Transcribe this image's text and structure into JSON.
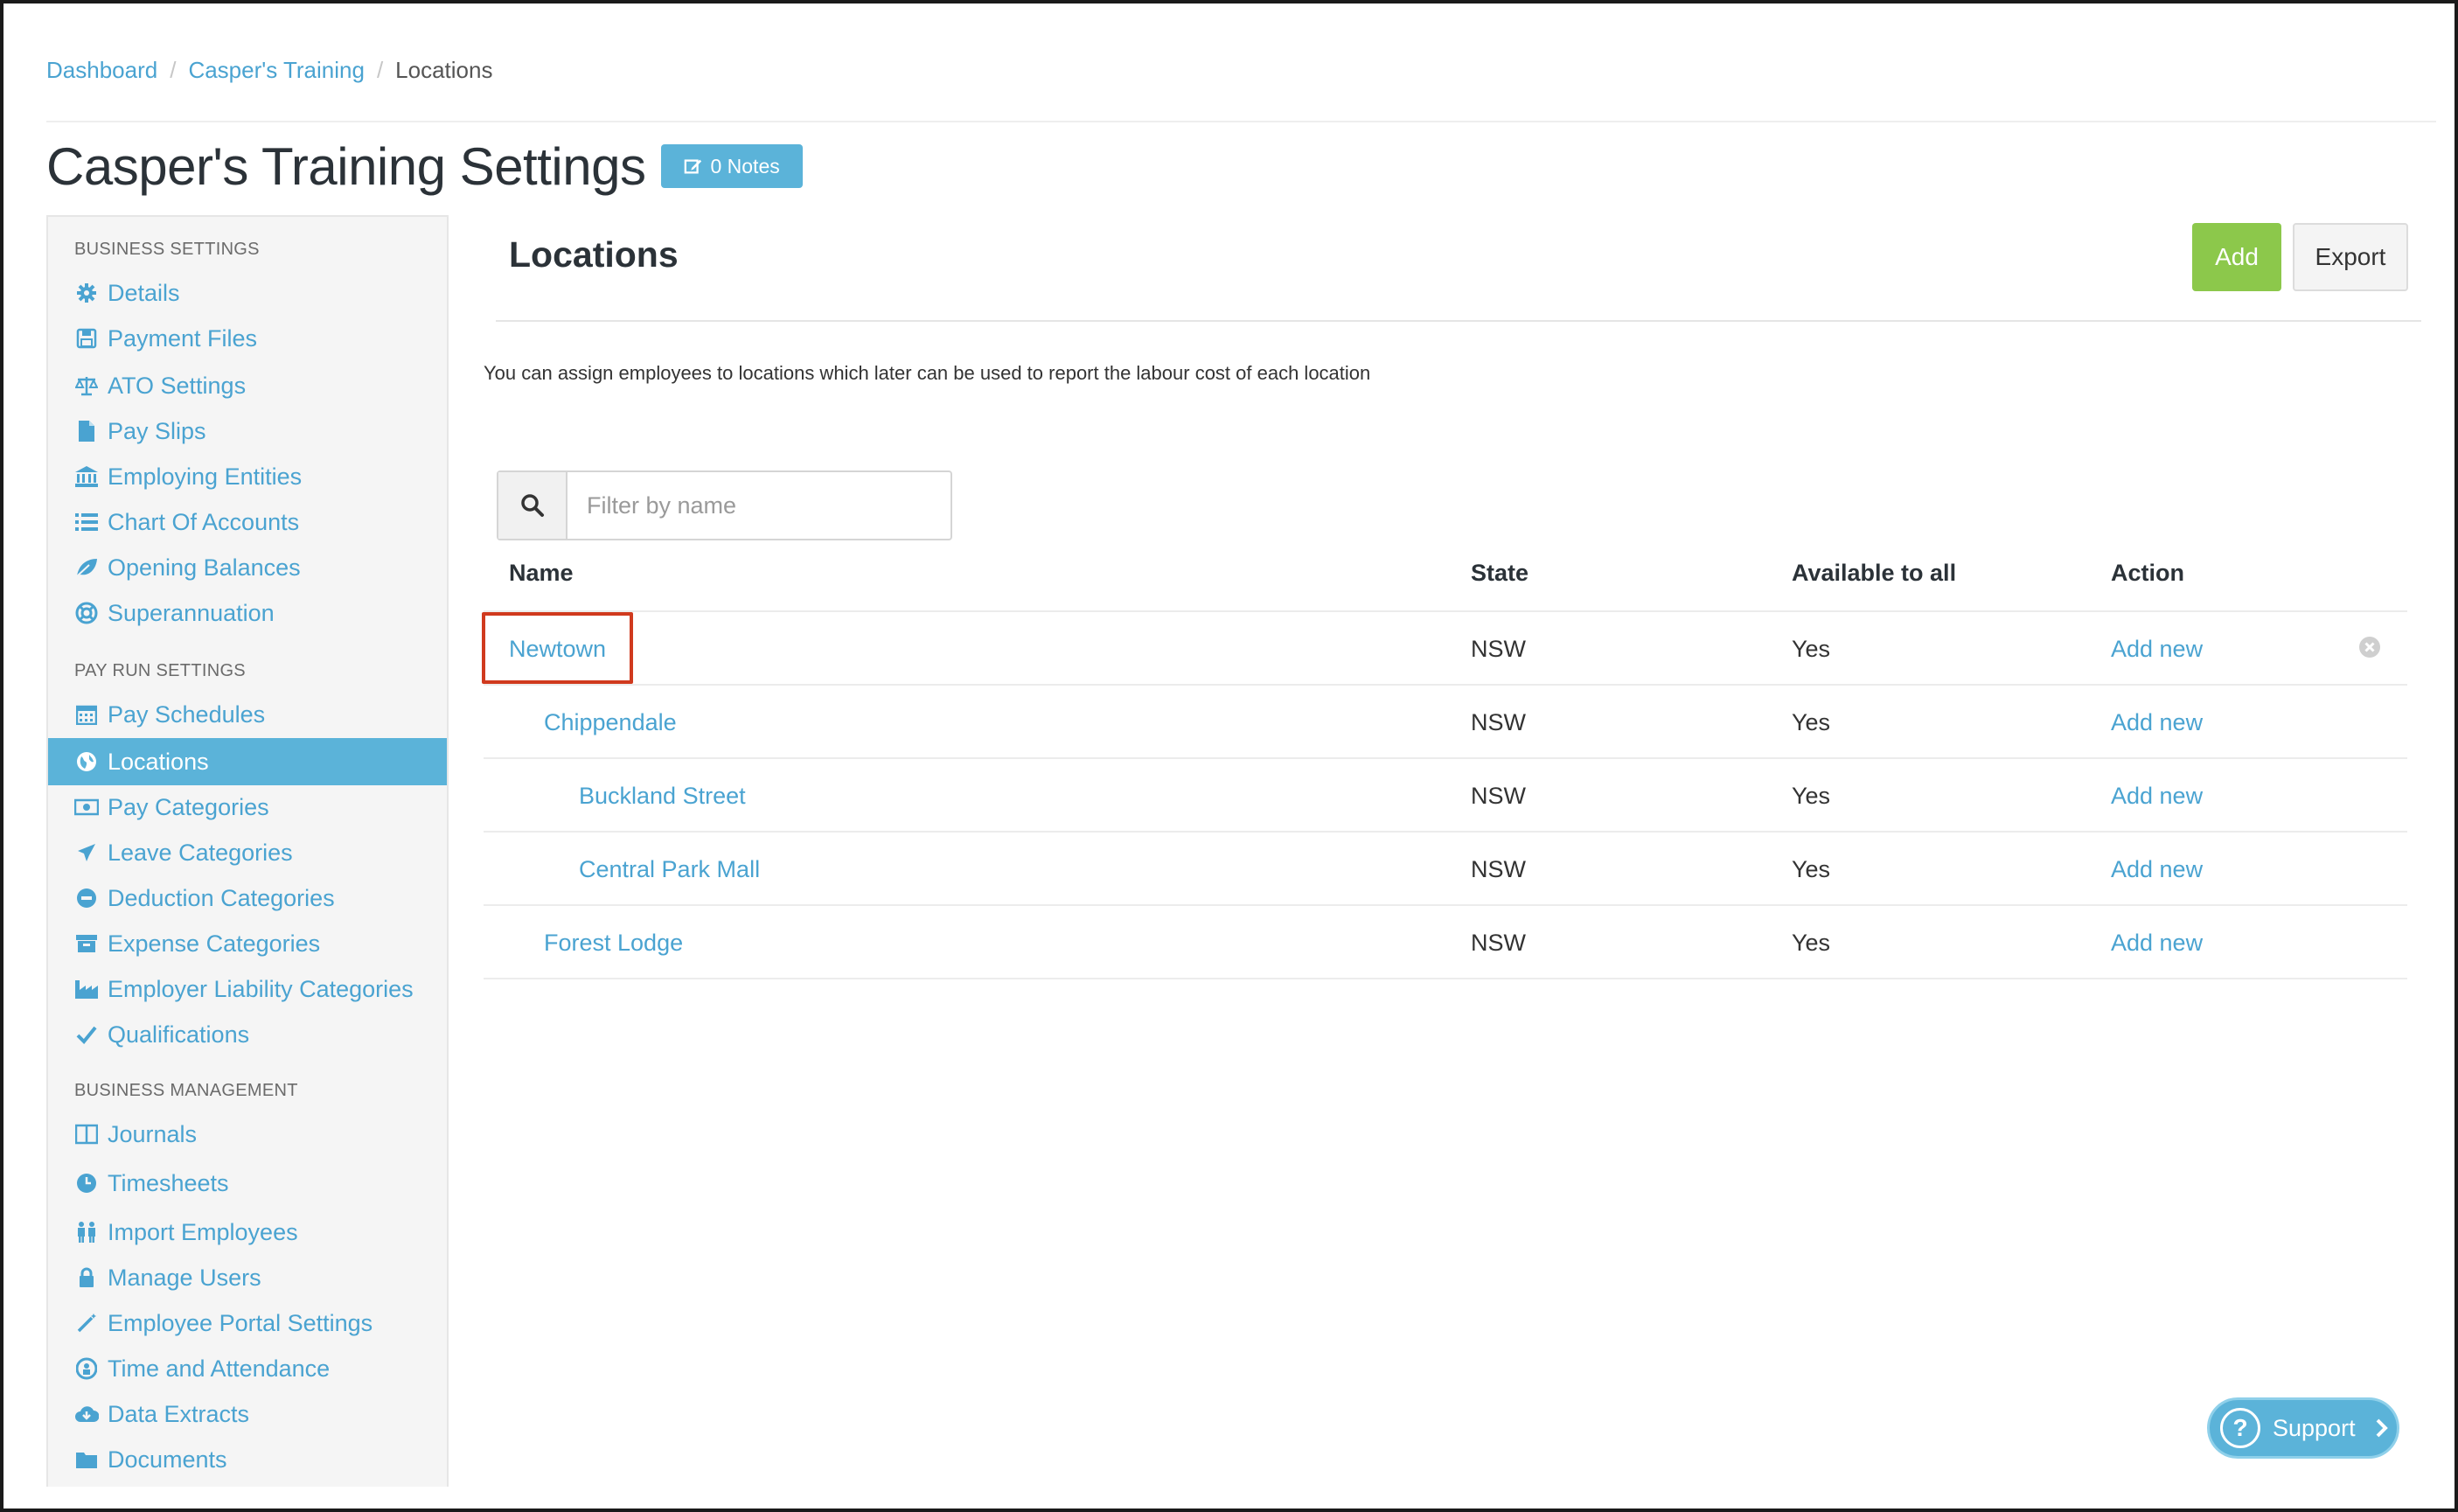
{
  "breadcrumb": {
    "items": [
      "Dashboard",
      "Casper's Training"
    ],
    "current": "Locations",
    "separator": "/"
  },
  "page": {
    "title": "Casper's Training Settings",
    "notes_badge": "0 Notes"
  },
  "sidebar": {
    "sections": [
      {
        "heading": "BUSINESS SETTINGS",
        "items": [
          {
            "label": "Details",
            "icon": "gear-icon"
          },
          {
            "label": "Payment Files",
            "icon": "floppy-disk-icon"
          },
          {
            "label": "ATO Settings",
            "icon": "balance-scale-icon"
          },
          {
            "label": "Pay Slips",
            "icon": "file-icon"
          },
          {
            "label": "Employing Entities",
            "icon": "bank-icon"
          },
          {
            "label": "Chart Of Accounts",
            "icon": "list-icon"
          },
          {
            "label": "Opening Balances",
            "icon": "leaf-icon"
          },
          {
            "label": "Superannuation",
            "icon": "life-ring-icon"
          }
        ]
      },
      {
        "heading": "PAY RUN SETTINGS",
        "items": [
          {
            "label": "Pay Schedules",
            "icon": "calendar-icon"
          },
          {
            "label": "Locations",
            "icon": "globe-icon",
            "active": true
          },
          {
            "label": "Pay Categories",
            "icon": "money-icon"
          },
          {
            "label": "Leave Categories",
            "icon": "plane-icon"
          },
          {
            "label": "Deduction Categories",
            "icon": "minus-circle-icon"
          },
          {
            "label": "Expense Categories",
            "icon": "archive-icon"
          },
          {
            "label": "Employer Liability Categories",
            "icon": "industry-icon"
          },
          {
            "label": "Qualifications",
            "icon": "check-icon"
          }
        ]
      },
      {
        "heading": "BUSINESS MANAGEMENT",
        "items": [
          {
            "label": "Journals",
            "icon": "columns-icon"
          },
          {
            "label": "Timesheets",
            "icon": "clock-icon"
          },
          {
            "label": "Import Employees",
            "icon": "people-icon"
          },
          {
            "label": "Manage Users",
            "icon": "lock-icon"
          },
          {
            "label": "Employee Portal Settings",
            "icon": "magic-wand-icon"
          },
          {
            "label": "Time and Attendance",
            "icon": "time-badge-icon"
          },
          {
            "label": "Data Extracts",
            "icon": "cloud-download-icon"
          },
          {
            "label": "Documents",
            "icon": "folder-icon"
          }
        ]
      }
    ]
  },
  "main": {
    "title": "Locations",
    "add_label": "Add",
    "export_label": "Export",
    "description": "You can assign employees to locations which later can be used to report the labour cost of each location",
    "filter_placeholder": "Filter by name"
  },
  "table": {
    "headers": {
      "name": "Name",
      "state": "State",
      "available": "Available to all",
      "action": "Action"
    },
    "rows": [
      {
        "name": "Newtown",
        "indent": 0,
        "state": "NSW",
        "available": "Yes",
        "action": "Add new"
      },
      {
        "name": "Chippendale",
        "indent": 1,
        "state": "NSW",
        "available": "Yes",
        "action": "Add new"
      },
      {
        "name": "Buckland Street",
        "indent": 2,
        "state": "NSW",
        "available": "Yes",
        "action": "Add new"
      },
      {
        "name": "Central Park Mall",
        "indent": 2,
        "state": "NSW",
        "available": "Yes",
        "action": "Add new"
      },
      {
        "name": "Forest Lodge",
        "indent": 1,
        "state": "NSW",
        "available": "Yes",
        "action": "Add new"
      }
    ]
  },
  "support": {
    "label": "Support",
    "icon": "question-circle-icon"
  },
  "colors": {
    "link": "#4aa3d1",
    "accent": "#5bb3d9",
    "add_button": "#8cc84b",
    "highlight": "#d03a1e"
  }
}
